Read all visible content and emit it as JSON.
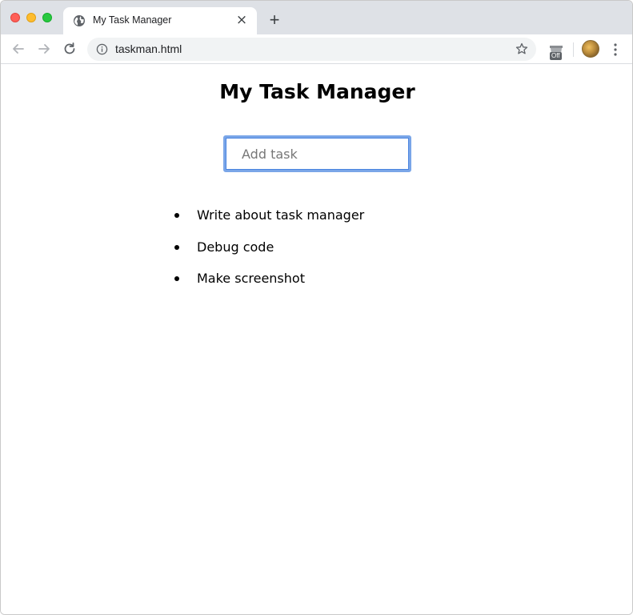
{
  "browser": {
    "tab": {
      "title": "My Task Manager",
      "favicon": "globe-icon",
      "close": "close-icon"
    },
    "new_tab_label": "+",
    "toolbar": {
      "back": "back-arrow-icon",
      "forward": "forward-arrow-icon",
      "reload": "reload-icon",
      "url": "taskman.html",
      "info": "info-icon",
      "bookmark": "star-icon",
      "extension_badge": "Off",
      "menu": "kebab-menu-icon"
    }
  },
  "page": {
    "title": "My Task Manager",
    "input": {
      "placeholder": "Add task",
      "value": ""
    },
    "tasks": [
      {
        "label": "Write about task manager"
      },
      {
        "label": "Debug code"
      },
      {
        "label": "Make screenshot"
      }
    ]
  },
  "colors": {
    "input_border": "#7aa6e8",
    "tabstrip_bg": "#dee1e6",
    "omnibox_bg": "#f1f3f4"
  }
}
